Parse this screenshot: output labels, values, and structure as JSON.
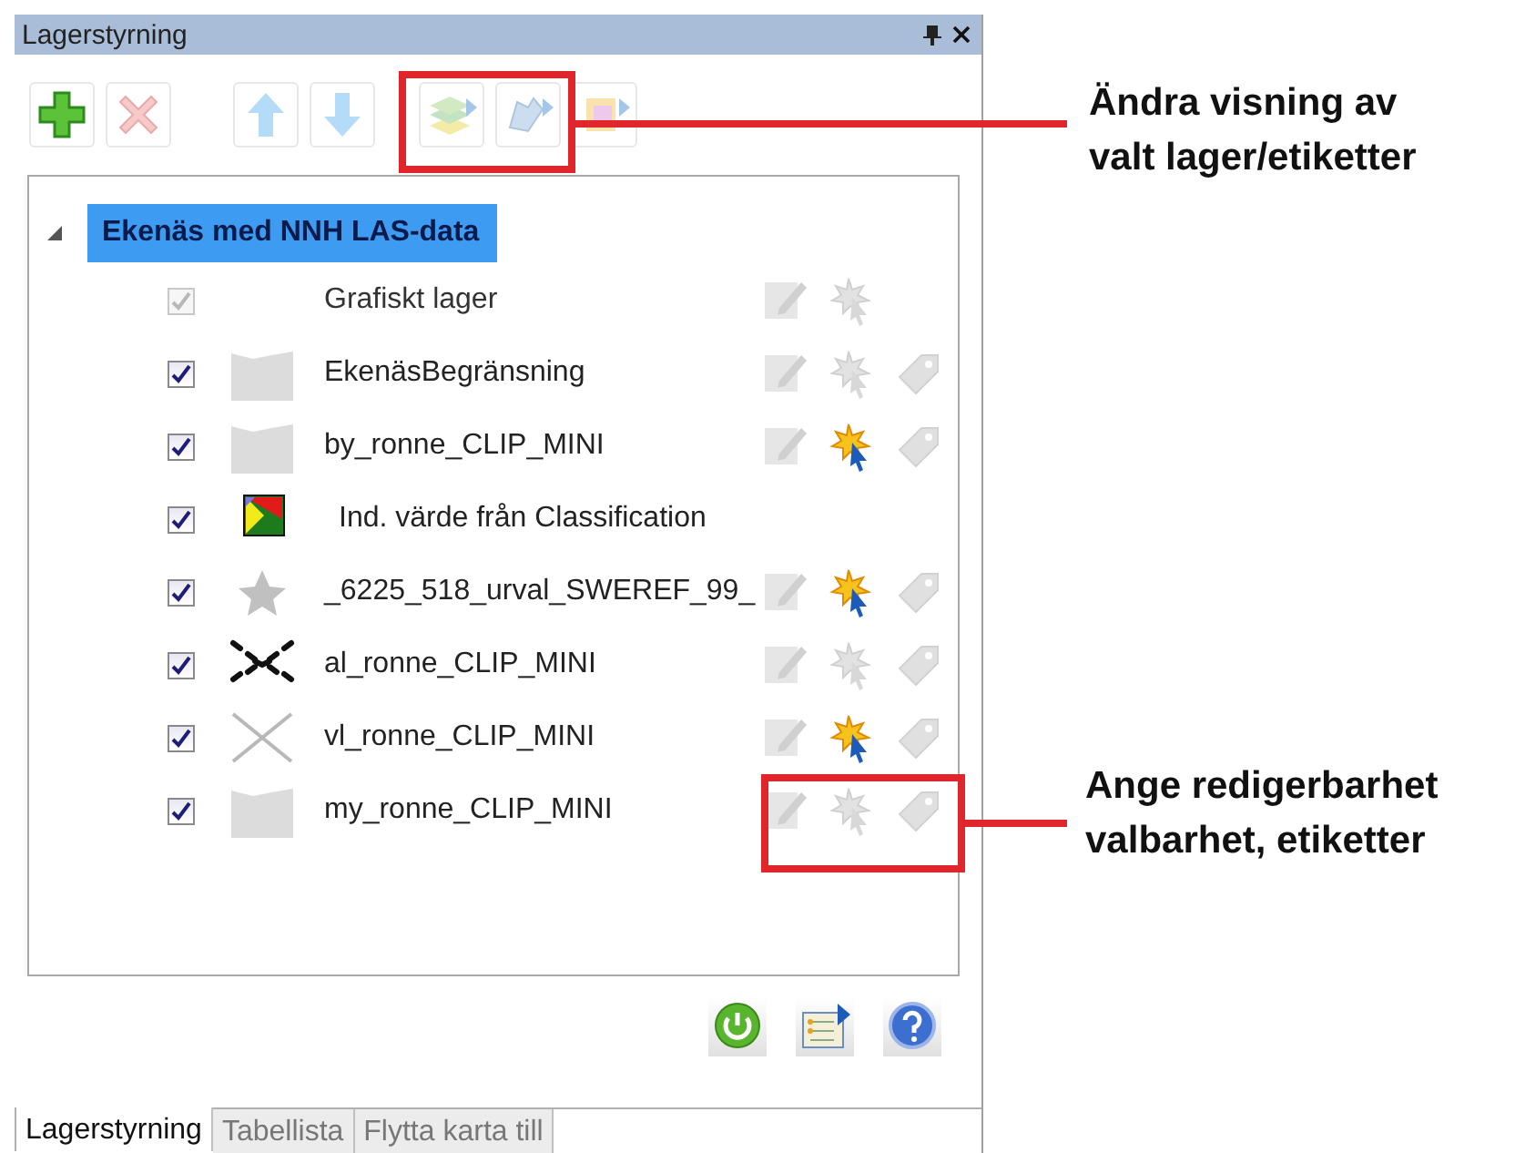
{
  "window": {
    "title": "Lagerstyrning"
  },
  "toolbar": [
    {
      "kind": "add",
      "disabled": false
    },
    {
      "kind": "delete",
      "disabled": true
    },
    {
      "kind": "up",
      "disabled": true
    },
    {
      "kind": "down",
      "disabled": true
    },
    {
      "kind": "layer-style",
      "disabled": true
    },
    {
      "kind": "label-style",
      "disabled": true
    },
    {
      "kind": "theme",
      "disabled": true
    }
  ],
  "tree": {
    "label": "Ekenäs med NNH LAS-data",
    "expanded": true,
    "selected": true,
    "children": [
      {
        "label": "Grafiskt lager",
        "checked": true,
        "disabled": true,
        "kind": "graphic",
        "tools": [
          {
            "kind": "edit",
            "on": false
          },
          {
            "kind": "select",
            "on": false
          }
        ]
      },
      {
        "label": "EkenäsBegränsning",
        "checked": true,
        "disabled": false,
        "kind": "polygon",
        "tools": [
          {
            "kind": "edit",
            "on": false
          },
          {
            "kind": "select",
            "on": false
          },
          {
            "kind": "label",
            "on": false
          }
        ]
      },
      {
        "label": "by_ronne_CLIP_MINI",
        "checked": true,
        "disabled": false,
        "kind": "polygon",
        "tools": [
          {
            "kind": "edit",
            "on": false
          },
          {
            "kind": "select",
            "on": true
          },
          {
            "kind": "label",
            "on": false
          }
        ]
      },
      {
        "label": "Ind. värde från Classification",
        "checked": true,
        "disabled": false,
        "kind": "raster"
      },
      {
        "label": "_6225_518_urval_SWEREF_99_",
        "checked": true,
        "disabled": false,
        "kind": "point",
        "tools": [
          {
            "kind": "edit",
            "on": false
          },
          {
            "kind": "select",
            "on": true
          },
          {
            "kind": "label",
            "on": false
          }
        ]
      },
      {
        "label": "al_ronne_CLIP_MINI",
        "checked": true,
        "disabled": false,
        "kind": "dashed-line",
        "tools": [
          {
            "kind": "edit",
            "on": false
          },
          {
            "kind": "select",
            "on": false
          },
          {
            "kind": "label",
            "on": false
          }
        ]
      },
      {
        "label": "vl_ronne_CLIP_MINI",
        "checked": true,
        "disabled": false,
        "kind": "line",
        "tools": [
          {
            "kind": "edit",
            "on": false
          },
          {
            "kind": "select",
            "on": true
          },
          {
            "kind": "label",
            "on": false
          }
        ]
      },
      {
        "label": "my_ronne_CLIP_MINI",
        "checked": true,
        "disabled": false,
        "kind": "polygon",
        "tools": [
          {
            "kind": "edit",
            "on": false
          },
          {
            "kind": "select",
            "on": false
          },
          {
            "kind": "label",
            "on": false
          }
        ]
      }
    ]
  },
  "footer_buttons": [
    {
      "kind": "power"
    },
    {
      "kind": "list-export"
    },
    {
      "kind": "help"
    }
  ],
  "tabs": [
    {
      "label": "Lagerstyrning",
      "selected": true
    },
    {
      "label": "Tabellista",
      "selected": false
    },
    {
      "label": "Flytta karta till",
      "selected": false
    }
  ],
  "annotations": [
    {
      "lines": [
        "Ändra visning av",
        "valt lager/etiketter"
      ]
    },
    {
      "lines": [
        "Ange redigerbarhet",
        "valbarhet, etiketter"
      ]
    }
  ]
}
